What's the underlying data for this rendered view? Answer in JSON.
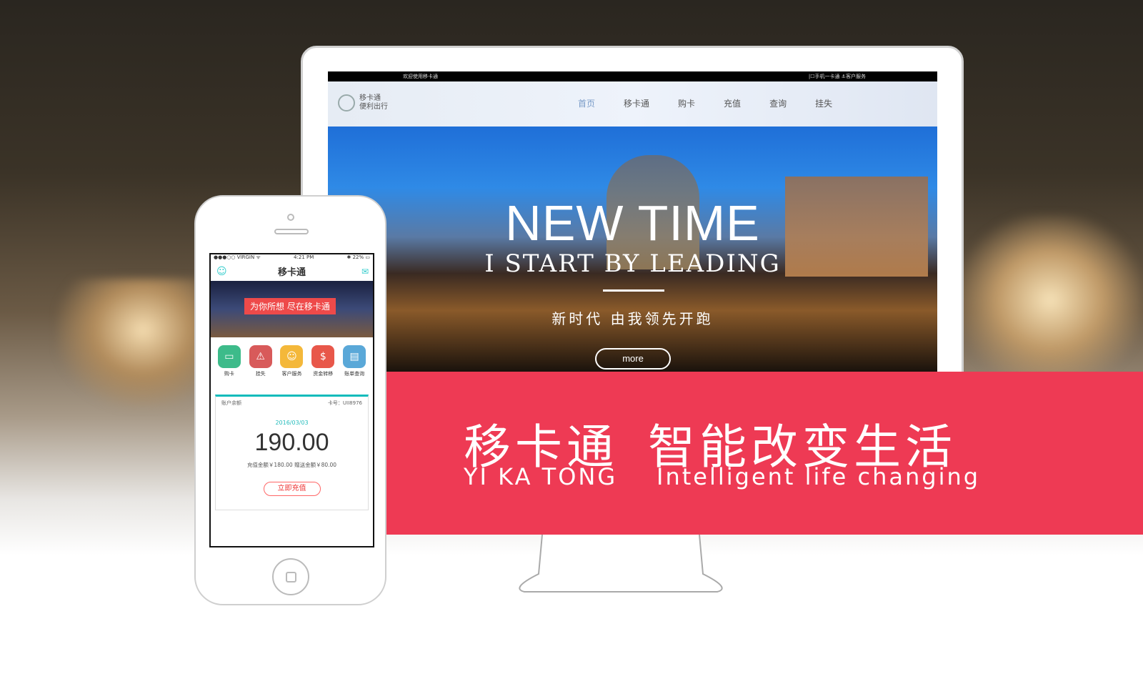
{
  "website": {
    "topbar_left": "欢迎使用移卡通",
    "topbar_right": "|☐手机一卡通  ⚓客户服务",
    "logo_line1": "移卡通",
    "logo_line2": "便利出行",
    "menu": [
      "首页",
      "移卡通",
      "购卡",
      "充值",
      "查询",
      "挂失"
    ],
    "hero_title": "NEW TIME",
    "hero_subtitle": "I START BY LEADING",
    "hero_cn": "新时代 由我领先开跑",
    "more_label": "more"
  },
  "banner": {
    "cn_left": "移卡通",
    "cn_right": "智能改变生活",
    "en_left": "YI KA TONG",
    "en_right": "Intelligent life changing",
    "color": "#ee3a54"
  },
  "app": {
    "carrier": "●●●○○ VIRGIN ᯤ",
    "time": "4:21 PM",
    "battery": "✱ 22% ▭",
    "title": "移卡通",
    "banner_text": "为你所想 尽在移卡通",
    "icons": [
      {
        "label": "购卡",
        "color": "#3dbb8a",
        "glyph": "▭"
      },
      {
        "label": "挂失",
        "color": "#d85a5a",
        "glyph": "⚠"
      },
      {
        "label": "客户服务",
        "color": "#f4b83a",
        "glyph": "☺"
      },
      {
        "label": "资金转移",
        "color": "#e8574a",
        "glyph": "$"
      },
      {
        "label": "账单查询",
        "color": "#5aa8d8",
        "glyph": "▤"
      }
    ],
    "card": {
      "label": "账户余额",
      "card_no": "卡号：UII8976",
      "date": "2016/03/03",
      "amount": "190.00",
      "detail": "充值金额￥180.00   赠送金额￥80.00",
      "button": "立即充值"
    }
  }
}
